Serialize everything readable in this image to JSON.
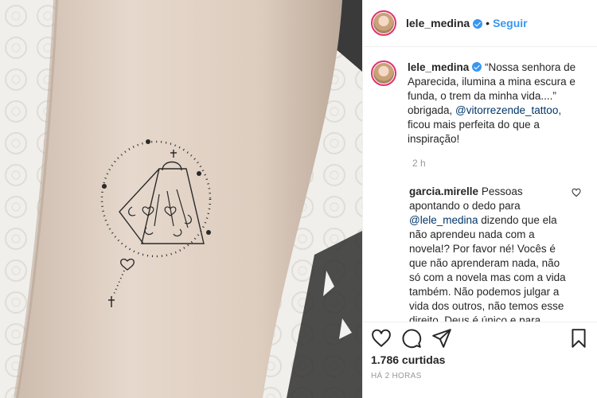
{
  "header": {
    "username": "lele_medina",
    "separator": "•",
    "follow_label": "Seguir"
  },
  "caption": {
    "username": "lele_medina",
    "text_before": " “Nossa senhora de Aparecida, ilumina a mina escura e funda, o trem da minha vida....” obrigada, ",
    "mention": "@vitorrezende_tattoo",
    "text_after": ", ficou mais perfeita do que a inspiração!",
    "time": "2 h"
  },
  "comment": {
    "username": "garcia.mirelle",
    "text_before": " Pessoas apontando o dedo para ",
    "mention": "@lele_medina",
    "text_after": " dizendo que ela não aprendeu nada com a novela!? Por favor né! Vocês é que não aprenderam nada, não só com a novela mas com a vida também. Não podemos julgar a vida dos outros, não temos esse direito. Deus é único e para todos! O fato dela ter feito uma tatuagem não diminui sua capacidade, suas"
  },
  "likes": "1.786 curtidas",
  "posted_ago": "HÁ 2 HORAS",
  "icons": {
    "verified": "verified-badge-icon",
    "like": "heart-outline-icon",
    "comment": "comment-bubble-icon",
    "share": "paper-plane-icon",
    "save": "bookmark-icon"
  },
  "colors": {
    "accent": "#3897f0",
    "text": "#262626",
    "muted": "#999999",
    "mention": "#003569",
    "border": "#efefef"
  }
}
